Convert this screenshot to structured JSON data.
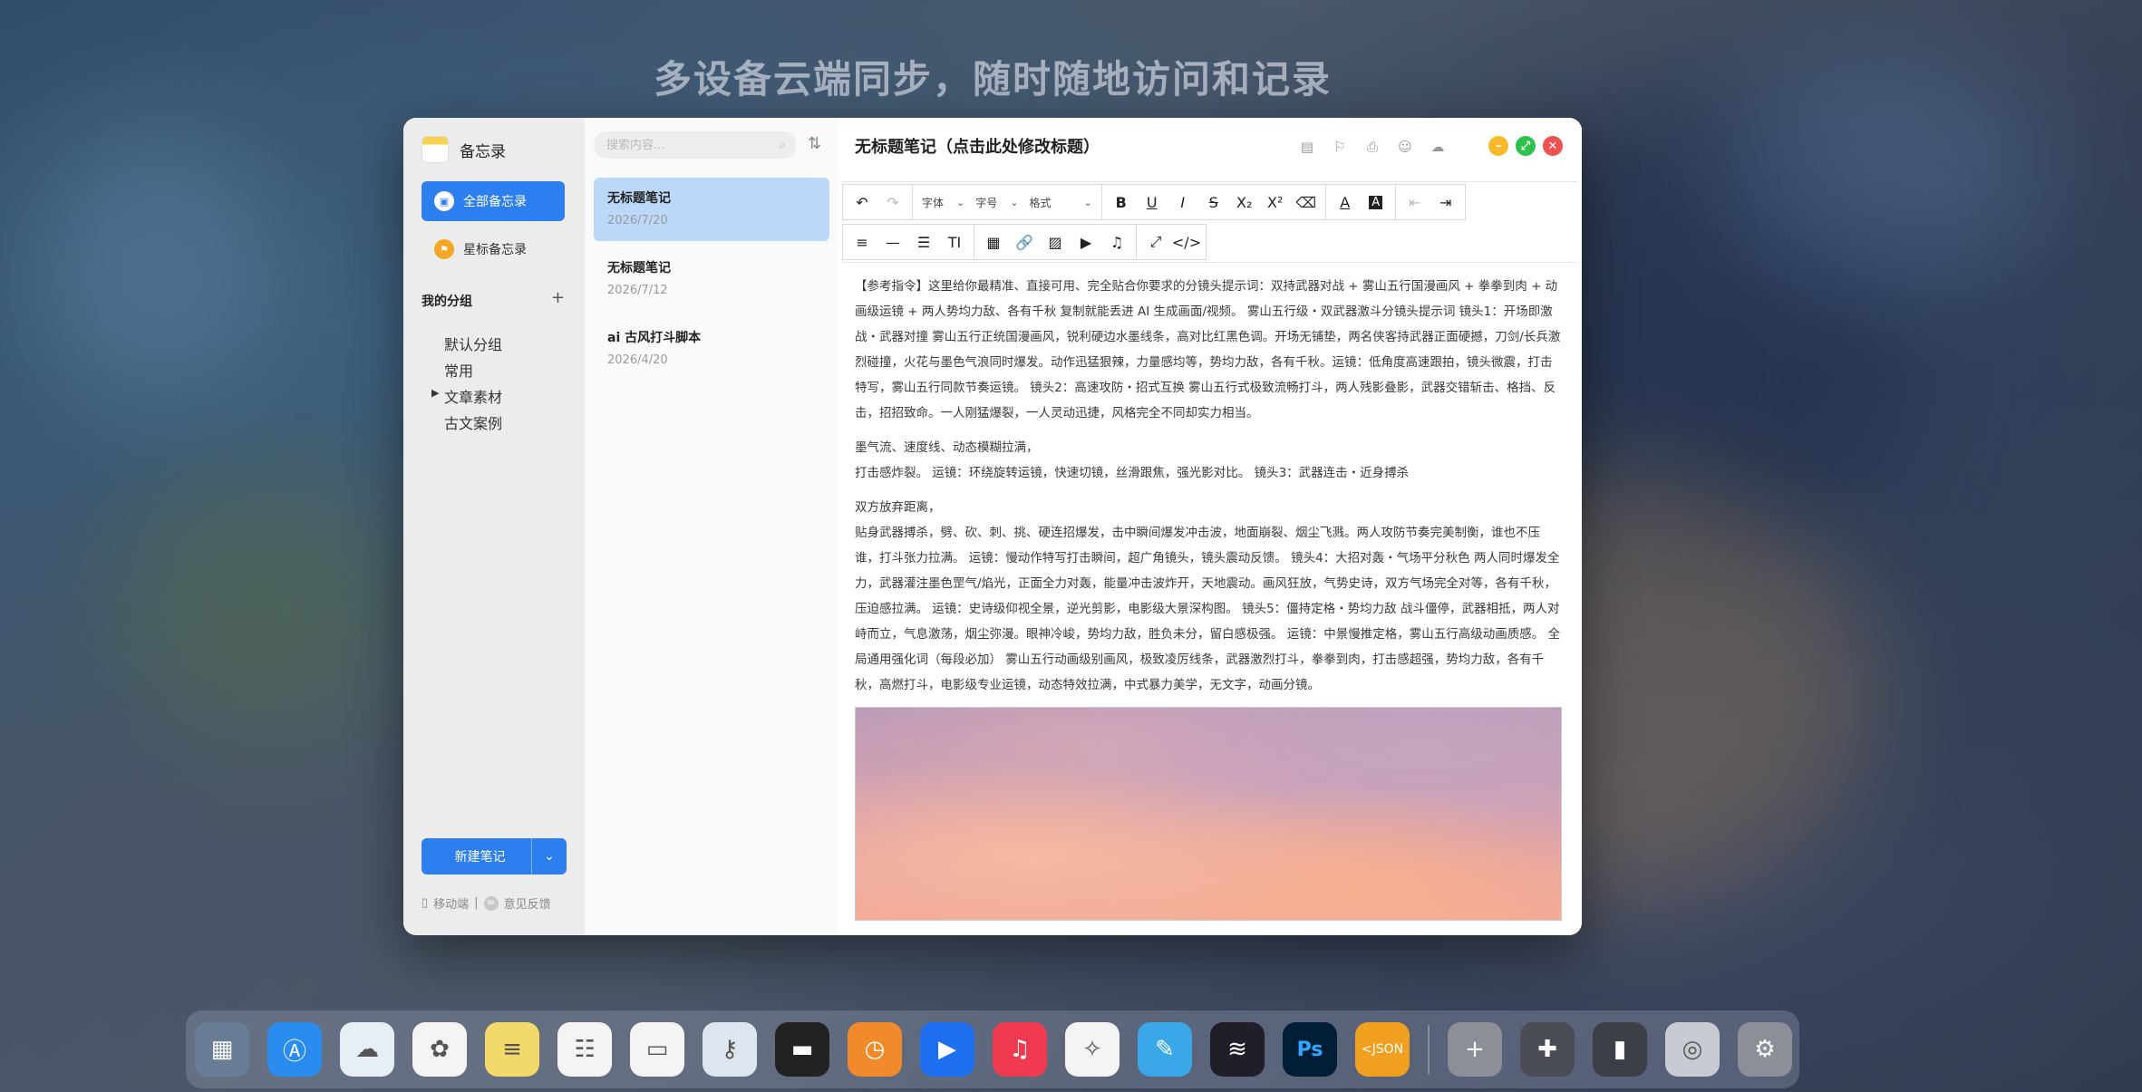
{
  "headline": "多设备云端同步，随时随地访问和记录",
  "sidebar": {
    "app_name": "备忘录",
    "nav": [
      {
        "label": "全部备忘录",
        "icon": "all-notes-icon"
      },
      {
        "label": "星标备忘录",
        "icon": "star-flag-icon"
      }
    ],
    "groups_title": "我的分组",
    "groups_add": "+",
    "groups": [
      "默认分组",
      "常用",
      "文章素材",
      "古文案例"
    ],
    "new_note": "新建笔记",
    "mobile_label": "移动端",
    "feedback_label": "意见反馈",
    "divider": "|"
  },
  "notelist": {
    "search_placeholder": "搜索内容...",
    "notes": [
      {
        "title": "无标题笔记",
        "date": "2026/7/20"
      },
      {
        "title": "无标题笔记",
        "date": "2026/7/12"
      },
      {
        "title": "ai 古风打斗脚本",
        "date": "2026/4/20"
      }
    ]
  },
  "editor": {
    "title": "无标题笔记（点击此处修改标题）",
    "font_label": "字体",
    "size_label": "字号",
    "format_label": "格式",
    "paragraphs": [
      "【参考指令】这里给你最精准、直接可用、完全贴合你要求的分镜头提示词：双持武器对战 + 雾山五行国漫画风 + 拳拳到肉 + 动画级运镜 + 两人势均力敌、各有千秋 复制就能丢进 AI 生成画面/视频。 雾山五行级・双武器激斗分镜头提示词 镜头1：开场即激战・武器对撞 雾山五行正统国漫画风，锐利硬边水墨线条，高对比红黑色调。开场无铺垫，两名侠客持武器正面硬撼，刀剑/长兵激烈碰撞，火花与墨色气浪同时爆发。动作迅猛狠辣，力量感均等，势均力敌，各有千秋。运镜：低角度高速跟拍，镜头微震，打击特写，雾山五行同款节奏运镜。 镜头2：高速攻防・招式互换 雾山五行式极致流畅打斗，两人残影叠影，武器交错斩击、格挡、反击，招招致命。一人刚猛爆裂，一人灵动迅捷，风格完全不同却实力相当。",
      "墨气流、速度线、动态模糊拉满，\n打击感炸裂。 运镜：环绕旋转运镜，快速切镜，丝滑跟焦，强光影对比。 镜头3：武器连击・近身搏杀",
      "双方放弃距离，\n贴身武器搏杀，劈、砍、刺、挑、硬连招爆发，击中瞬间爆发冲击波，地面崩裂、烟尘飞溅。两人攻防节奏完美制衡，谁也不压谁，打斗张力拉满。 运镜：慢动作特写打击瞬间，超广角镜头，镜头震动反馈。 镜头4：大招对轰・气场平分秋色 两人同时爆发全力，武器灌注墨色罡气/焰光，正面全力对轰，能量冲击波炸开，天地震动。画风狂放，气势史诗，双方气场完全对等，各有千秋，压迫感拉满。 运镜：史诗级仰视全景，逆光剪影，电影级大景深构图。 镜头5：僵持定格・势均力敌 战斗僵停，武器相抵，两人对峙而立，气息激荡，烟尘弥漫。眼神冷峻，势均力敌，胜负未分，留白感极强。 运镜：中景慢推定格，雾山五行高级动画质感。 全局通用强化词（每段必加） 雾山五行动画级别画风，极致凌厉线条，武器激烈打斗，拳拳到肉，打击感超强，势均力敌，各有千秋，高燃打斗，电影级专业运镜，动态特效拉满，中式暴力美学，无文字，动画分镜。"
    ]
  },
  "dock": [
    {
      "icon": "launchpad-icon",
      "color": "#6a7d96"
    },
    {
      "icon": "app-store-icon",
      "color": "#2b8cf0"
    },
    {
      "icon": "icloud-icon",
      "color": "#e8eef6"
    },
    {
      "icon": "photos-icon",
      "color": "#f4f4f4"
    },
    {
      "icon": "notes-icon",
      "color": "#f3d86a"
    },
    {
      "icon": "reminders-icon",
      "color": "#f4f4f4"
    },
    {
      "icon": "calendar-icon",
      "color": "#f4f4f4"
    },
    {
      "icon": "keychain-icon",
      "color": "#dde5ee"
    },
    {
      "icon": "wallet-icon",
      "color": "#222"
    },
    {
      "icon": "clock-icon",
      "color": "#f08a2a"
    },
    {
      "icon": "play-icon",
      "color": "#1e6ef0"
    },
    {
      "icon": "music-icon",
      "color": "#f03a4f"
    },
    {
      "icon": "safari-icon",
      "color": "#f4f4f4"
    },
    {
      "icon": "pen-icon",
      "color": "#3aa8e8"
    },
    {
      "icon": "beyond-compare-icon",
      "color": "#1f1f2a"
    },
    {
      "icon": "photoshop-icon",
      "color": "#001e36"
    },
    {
      "icon": "json-icon",
      "color": "#f0a01e"
    },
    {
      "icon": "add-icon",
      "color": "#8a8f98"
    },
    {
      "icon": "puzzle-icon",
      "color": "#4a4d55"
    },
    {
      "icon": "brush-icon",
      "color": "#3c3f46"
    },
    {
      "icon": "lock-gear-icon",
      "color": "#c7ccd3"
    },
    {
      "icon": "settings-icon",
      "color": "#8b9098"
    }
  ],
  "dock_json_label": "<JSON",
  "dock_ps_label": "Ps"
}
